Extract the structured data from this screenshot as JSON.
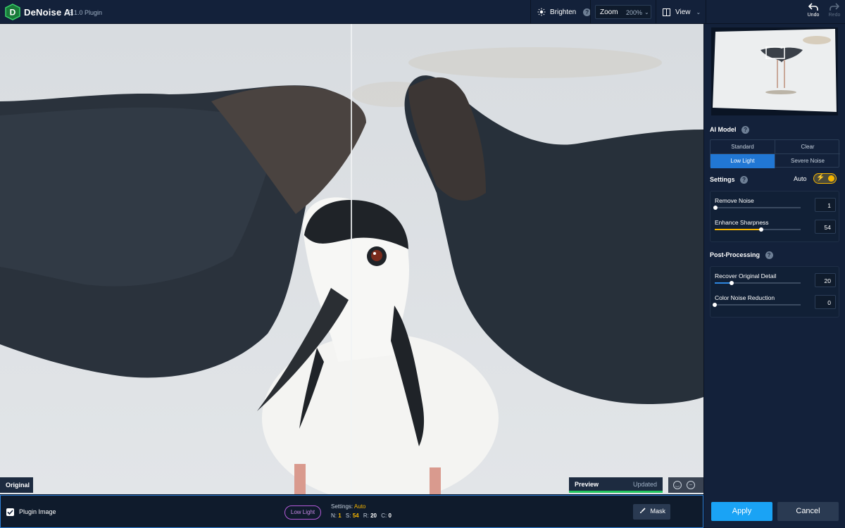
{
  "app": {
    "name": "DeNoise AI",
    "version": "v3.1.0 Plugin",
    "logo_letter": "D"
  },
  "toolbar": {
    "brighten_label": "Brighten",
    "help_glyph": "?",
    "zoom_label": "Zoom",
    "zoom_value": "200%",
    "view_label": "View",
    "undo_label": "Undo",
    "redo_label": "Redo"
  },
  "canvas": {
    "original_label": "Original",
    "preview_label": "Preview",
    "preview_status": "Updated"
  },
  "bottom": {
    "plugin_image_label": "Plugin Image",
    "plugin_image_checked": true,
    "model_pill": "Low Light",
    "settings_prefix": "Settings:",
    "settings_mode": "Auto",
    "n_label": "N:",
    "n_value": "1",
    "s_label": "S:",
    "s_value": "54",
    "r_label": "R:",
    "r_value": "20",
    "c_label": "C:",
    "c_value": "0",
    "mask_label": "Mask"
  },
  "panel": {
    "ai_model_title": "AI Model",
    "models": [
      {
        "label": "Standard",
        "active": false
      },
      {
        "label": "Clear",
        "active": false
      },
      {
        "label": "Low Light",
        "active": true
      },
      {
        "label": "Severe Noise",
        "active": false
      }
    ],
    "settings_title": "Settings",
    "auto_label": "Auto",
    "auto_on": true,
    "sliders": [
      {
        "label": "Remove Noise",
        "value": "1",
        "fraction": 0.01,
        "color": "#ffffff"
      },
      {
        "label": "Enhance Sharpness",
        "value": "54",
        "fraction": 0.54,
        "color": "#f5b400"
      }
    ],
    "post_title": "Post-Processing",
    "post_sliders": [
      {
        "label": "Recover Original Detail",
        "value": "20",
        "fraction": 0.2,
        "color": "#2e86de"
      },
      {
        "label": "Color Noise Reduction",
        "value": "0",
        "fraction": 0.0,
        "color": "#ffffff"
      }
    ],
    "apply_label": "Apply",
    "cancel_label": "Cancel"
  },
  "colors": {
    "accent": "#1aa3f5",
    "auto_yellow": "#f5b400",
    "low_light_purple": "#b35ad9",
    "progress_green": "#22c55e"
  }
}
